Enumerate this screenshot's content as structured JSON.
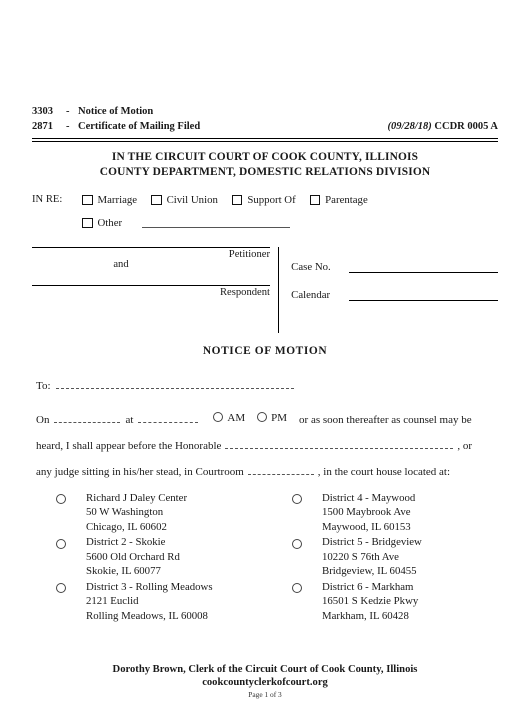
{
  "form_header": {
    "rows": [
      {
        "code": "3303",
        "dash": "-",
        "name": "Notice of Motion"
      },
      {
        "code": "2871",
        "dash": "-",
        "name": "Certificate of Mailing Filed"
      }
    ],
    "revision": "(09/28/18)",
    "form_id": "CCDR 0005 A"
  },
  "court_title": {
    "line1": "IN THE CIRCUIT COURT OF COOK COUNTY, ILLINOIS",
    "line2": "COUNTY DEPARTMENT, DOMESTIC RELATIONS DIVISION"
  },
  "in_re": {
    "label": "IN RE:",
    "options": [
      "Marriage",
      "Civil Union",
      "Support Of",
      "Parentage"
    ],
    "other_label": "Other"
  },
  "caption": {
    "petitioner_label": "Petitioner",
    "and_label": "and",
    "respondent_label": "Respondent",
    "case_no_label": "Case No.",
    "calendar_label": "Calendar"
  },
  "notice": {
    "title": "NOTICE OF MOTION",
    "to_label": "To:"
  },
  "body": {
    "line1_a": "On",
    "line1_b": "at",
    "am_label": "AM",
    "pm_label": "PM",
    "line1_c": "or as soon thereafter as counsel may be",
    "line2_a": "heard, I shall appear before the Honorable",
    "line2_b": ", or",
    "line3_a": "any judge sitting in his/her stead, in Courtroom",
    "line3_b": ", in the court house located at:"
  },
  "locations": {
    "left": [
      {
        "name": "Richard J Daley Center",
        "street": "50 W Washington",
        "city": "Chicago, IL 60602"
      },
      {
        "name": "District 2 - Skokie",
        "street": "5600 Old Orchard Rd",
        "city": "Skokie, IL 60077"
      },
      {
        "name": "District 3 - Rolling Meadows",
        "street": "2121 Euclid",
        "city": "Rolling Meadows, IL 60008"
      }
    ],
    "right": [
      {
        "name": "District 4 - Maywood",
        "street": "1500 Maybrook Ave",
        "city": "Maywood, IL 60153"
      },
      {
        "name": "District 5 - Bridgeview",
        "street": "10220 S 76th Ave",
        "city": "Bridgeview, IL 60455"
      },
      {
        "name": "District 6 - Markham",
        "street": "16501 S Kedzie Pkwy",
        "city": "Markham, IL 60428"
      }
    ]
  },
  "footer": {
    "clerk": "Dorothy Brown, Clerk of the Circuit Court of Cook County, Illinois",
    "url": "cookcountyclerkofcourt.org",
    "page": "Page 1 of 3"
  }
}
